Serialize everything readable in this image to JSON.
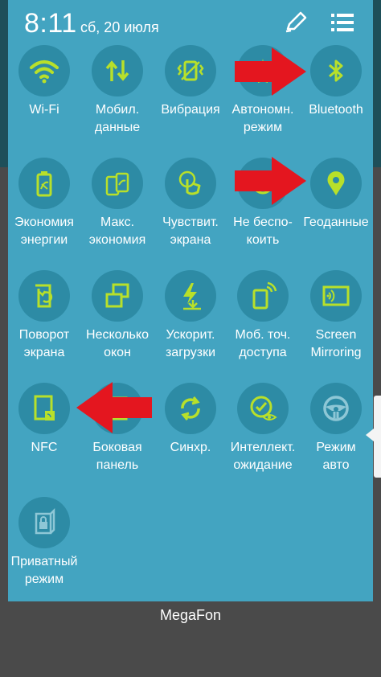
{
  "status_bar": {
    "time": "8:11",
    "date": "сб, 20 июля",
    "icons": [
      "edit-pencil-icon",
      "list-menu-icon"
    ]
  },
  "accent_colors": {
    "panel": "#43a4c1",
    "tile": "#2d8ba5",
    "icon": "#b8e02a",
    "arrow": "#e4161f"
  },
  "tiles": [
    {
      "label": "Wi-Fi",
      "icon": "wifi-icon"
    },
    {
      "label": "Мобил.\nданные",
      "icon": "mobile-data-icon"
    },
    {
      "label": "Вибрация",
      "icon": "vibration-icon"
    },
    {
      "label": "Автономн.\nрежим",
      "icon": "airplane-mode-icon"
    },
    {
      "label": "Bluetooth",
      "icon": "bluetooth-icon"
    },
    {
      "label": "Экономия\nэнергии",
      "icon": "power-saving-icon"
    },
    {
      "label": "Макс.\nэкономия",
      "icon": "ultra-power-saving-icon"
    },
    {
      "label": "Чувствит.\nэкрана",
      "icon": "touch-sensitivity-icon"
    },
    {
      "label": "Не беспо-\nкоить",
      "icon": "do-not-disturb-icon"
    },
    {
      "label": "Геоданные",
      "icon": "location-icon"
    },
    {
      "label": "Поворот\nэкрана",
      "icon": "screen-rotation-icon"
    },
    {
      "label": "Несколько\nокон",
      "icon": "multi-window-icon"
    },
    {
      "label": "Ускорит.\nзагрузки",
      "icon": "download-booster-icon"
    },
    {
      "label": "Моб. точ.\nдоступа",
      "icon": "mobile-hotspot-icon"
    },
    {
      "label": "Screen\nMirroring",
      "icon": "screen-mirroring-icon"
    },
    {
      "label": "NFC",
      "icon": "nfc-icon"
    },
    {
      "label": "Боковая\nпанель",
      "icon": "side-panel-icon"
    },
    {
      "label": "Синхр.",
      "icon": "sync-icon"
    },
    {
      "label": "Интеллект.\nожидание",
      "icon": "smart-stay-icon"
    },
    {
      "label": "Режим\nавто",
      "icon": "car-mode-icon"
    },
    {
      "label": "Приватный\nрежим",
      "icon": "private-mode-icon"
    }
  ],
  "carrier": "MegaFon"
}
